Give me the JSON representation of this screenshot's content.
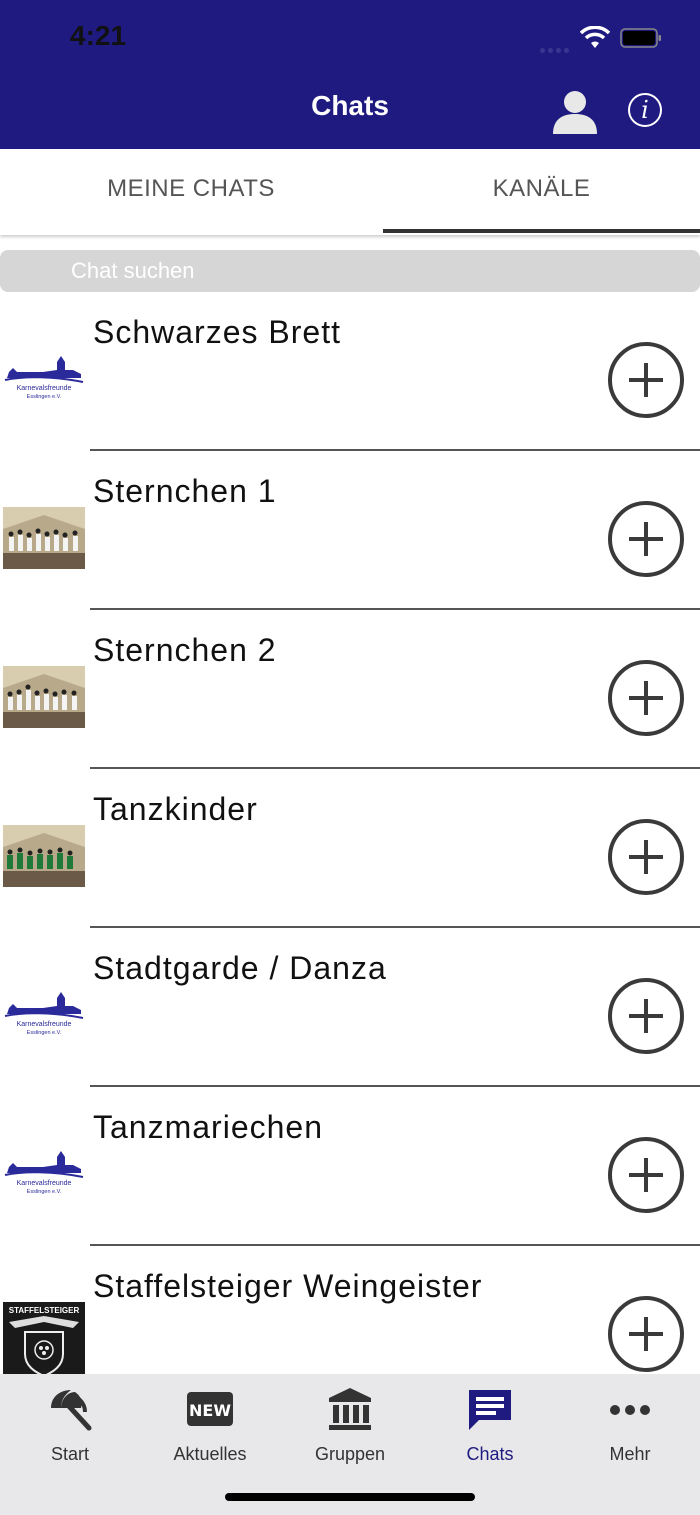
{
  "status": {
    "time": "4:21"
  },
  "header": {
    "title": "Chats",
    "profile_icon": "person-icon",
    "info_icon": "info-icon",
    "info_glyph": "i"
  },
  "tabs": [
    {
      "label": "MEINE CHATS",
      "active": false
    },
    {
      "label": "KANÄLE",
      "active": true
    }
  ],
  "search": {
    "placeholder": "Chat suchen"
  },
  "channels": [
    {
      "name": "Schwarzes Brett",
      "thumb": "karnevalsfreunde-logo",
      "logo_text": [
        "Karnevalsfreunde",
        "Esslingen e.V."
      ]
    },
    {
      "name": "Sternchen 1",
      "thumb": "stage-photo"
    },
    {
      "name": "Sternchen 2",
      "thumb": "stage-photo"
    },
    {
      "name": "Tanzkinder",
      "thumb": "stage-photo-green"
    },
    {
      "name": "Stadtgarde / Danza",
      "thumb": "karnevalsfreunde-logo",
      "logo_text": [
        "Karnevalsfreunde",
        "Esslingen e.V."
      ]
    },
    {
      "name": "Tanzmariechen",
      "thumb": "karnevalsfreunde-logo",
      "logo_text": [
        "Karnevalsfreunde",
        "Esslingen e.V."
      ]
    },
    {
      "name": "Staffelsteiger Weingeister",
      "thumb": "staffelsteiger-logo",
      "logo_text": [
        "STAFFELSTEIGER"
      ]
    }
  ],
  "tabbar": [
    {
      "label": "Start",
      "icon": "umbrella-icon",
      "active": false
    },
    {
      "label": "Aktuelles",
      "icon": "new-badge-icon",
      "icon_text": "NEW",
      "active": false
    },
    {
      "label": "Gruppen",
      "icon": "building-icon",
      "active": false
    },
    {
      "label": "Chats",
      "icon": "chat-icon",
      "active": true
    },
    {
      "label": "Mehr",
      "icon": "more-icon",
      "active": false
    }
  ],
  "colors": {
    "brand": "#1e1a80",
    "icon": "#333333",
    "tabbar_bg": "#e8e8ea"
  }
}
